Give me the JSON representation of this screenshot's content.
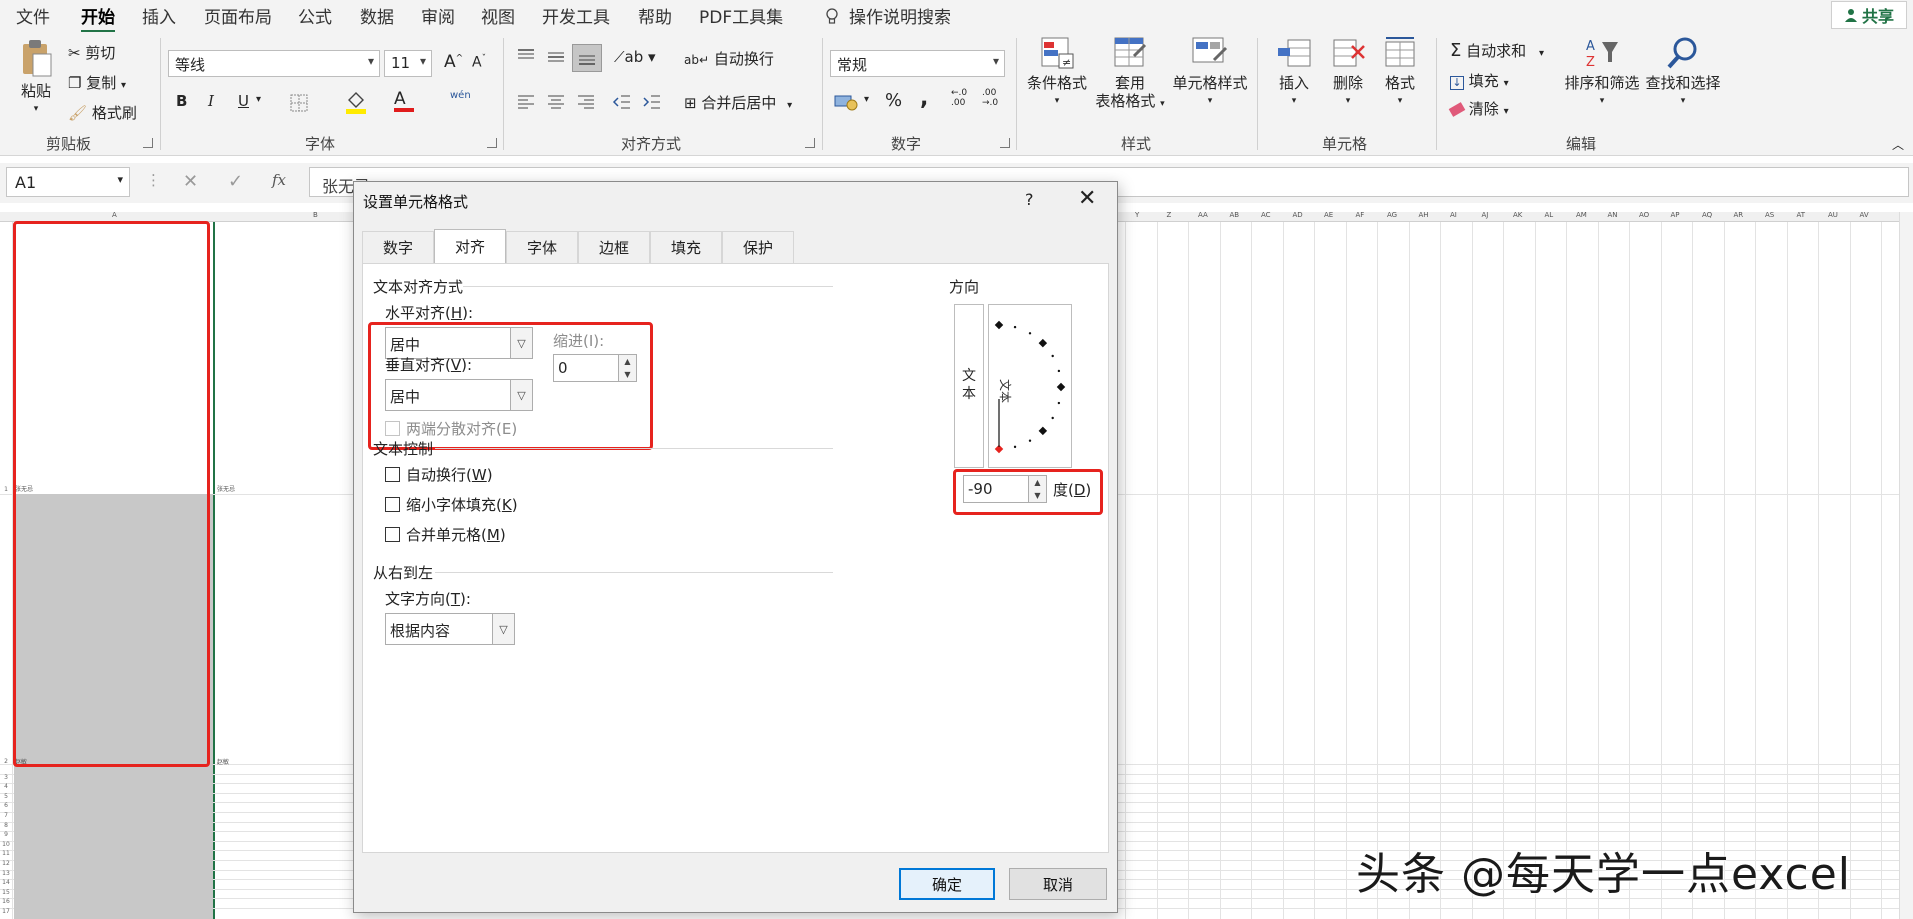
{
  "menu": {
    "tabs": [
      "文件",
      "开始",
      "插入",
      "页面布局",
      "公式",
      "数据",
      "审阅",
      "视图",
      "开发工具",
      "帮助",
      "PDF工具集"
    ],
    "active": "开始",
    "search": "操作说明搜索",
    "share": "共享"
  },
  "ribbon": {
    "clipboard": {
      "paste": "粘贴",
      "cut": "剪切",
      "copy": "复制",
      "format_painter": "格式刷",
      "label": "剪贴板"
    },
    "font": {
      "name": "等线",
      "size": "11",
      "grow": "A",
      "shrink": "A",
      "bold": "B",
      "italic": "I",
      "underline": "U",
      "color_letter": "A",
      "phonetic": "wén",
      "label": "字体"
    },
    "alignment": {
      "wrap": "自动换行",
      "merge": "合并后居中",
      "label": "对齐方式"
    },
    "number": {
      "format": "常规",
      "percent": "%",
      "comma": ",",
      "inc_decimal": "←.0 .00",
      "dec_decimal": ".00 →.0",
      "label": "数字"
    },
    "styles": {
      "conditional": "条件格式",
      "table_l1": "套用",
      "table_l2": "表格格式",
      "cell_styles": "单元格样式",
      "label": "样式"
    },
    "cells": {
      "insert": "插入",
      "delete": "删除",
      "format": "格式",
      "label": "单元格"
    },
    "editing": {
      "autosum": "自动求和",
      "fill": "填充",
      "clear": "清除",
      "sort": "排序和筛选",
      "find": "查找和选择",
      "label": "编辑"
    }
  },
  "formula_bar": {
    "name_box": "A1",
    "cancel": "✕",
    "enter": "✓",
    "fx": "fx",
    "content": "张无忌"
  },
  "grid": {
    "col_a": "A",
    "col_b": "B",
    "right_columns": [
      "Y",
      "Z",
      "AA",
      "AB",
      "AC",
      "AD",
      "AE",
      "AF",
      "AG",
      "AH",
      "AI",
      "AJ",
      "AK",
      "AL",
      "AM",
      "AN",
      "AO",
      "AP",
      "AQ",
      "AR",
      "AS",
      "AT",
      "AU",
      "AV"
    ],
    "a1": "张无忌",
    "b1": "张无忌",
    "a2": "赵敏",
    "b2": "赵敏",
    "row_numbers": [
      "1",
      "2",
      "3",
      "4",
      "5",
      "6",
      "7",
      "8",
      "9",
      "10",
      "11",
      "12",
      "13",
      "14",
      "15",
      "16",
      "17"
    ]
  },
  "dialog": {
    "title": "设置单元格格式",
    "help": "?",
    "close": "✕",
    "tabs": [
      "数字",
      "对齐",
      "字体",
      "边框",
      "填充",
      "保护"
    ],
    "active_tab": "对齐",
    "text_alignment": "文本对齐方式",
    "horizontal": {
      "label": "水平对齐(",
      "key": "H",
      "tail": "):",
      "value": "居中"
    },
    "indent": {
      "label": "缩进(I):",
      "value": "0"
    },
    "vertical": {
      "label": "垂直对齐(",
      "key": "V",
      "tail": "):",
      "value": "居中"
    },
    "distributed": "两端分散对齐(E)",
    "text_control": "文本控制",
    "wrap": {
      "label": "自动换行(",
      "key": "W",
      "tail": ")"
    },
    "shrink": {
      "label": "缩小字体填充(",
      "key": "K",
      "tail": ")"
    },
    "merge": {
      "label": "合并单元格(",
      "key": "M",
      "tail": ")"
    },
    "rtl": "从右到左",
    "text_direction": {
      "label": "文字方向(",
      "key": "T",
      "tail": "):",
      "value": "根据内容"
    },
    "orientation": {
      "label": "方向",
      "vertical_text_1": "文本",
      "vertical_text_2": "本",
      "indicator": "文本",
      "degrees": "-90",
      "degree_label": "度(",
      "degree_key": "D",
      "degree_tail": ")"
    },
    "ok": "确定",
    "cancel": "取消"
  },
  "watermark": "头条 @每天学一点excel",
  "colors": {
    "excel_green": "#217346",
    "highlight_red": "#e6231e",
    "selection_gray": "#c8c8c8"
  }
}
